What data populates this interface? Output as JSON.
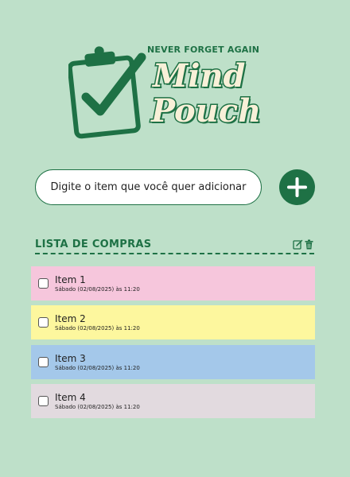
{
  "header": {
    "tagline": "NEVER FORGET AGAIN",
    "brand_line1": "Mind",
    "brand_line2": "Pouch"
  },
  "input": {
    "placeholder": "Digite o item que você quer adicionar"
  },
  "list": {
    "title": "LISTA DE COMPRAS",
    "items": [
      {
        "name": "Item 1",
        "date": "Sábado (02/08/2025) às 11:20",
        "color": "#f6c6dc"
      },
      {
        "name": "Item 2",
        "date": "Sábado (02/08/2025) às 11:20",
        "color": "#fdf79e"
      },
      {
        "name": "Item 3",
        "date": "Sábado (02/08/2025) às 11:20",
        "color": "#a4c8ea"
      },
      {
        "name": "Item 4",
        "date": "Sábado (02/08/2025) às 11:20",
        "color": "#e2dadf"
      }
    ]
  },
  "colors": {
    "background": "#bee0c9",
    "accent": "#1e7145",
    "brand_fill": "#f8f0d8"
  },
  "icons": {
    "logo": "clipboard-check-icon",
    "add": "plus-icon",
    "edit": "edit-icon",
    "delete": "trash-icon"
  }
}
